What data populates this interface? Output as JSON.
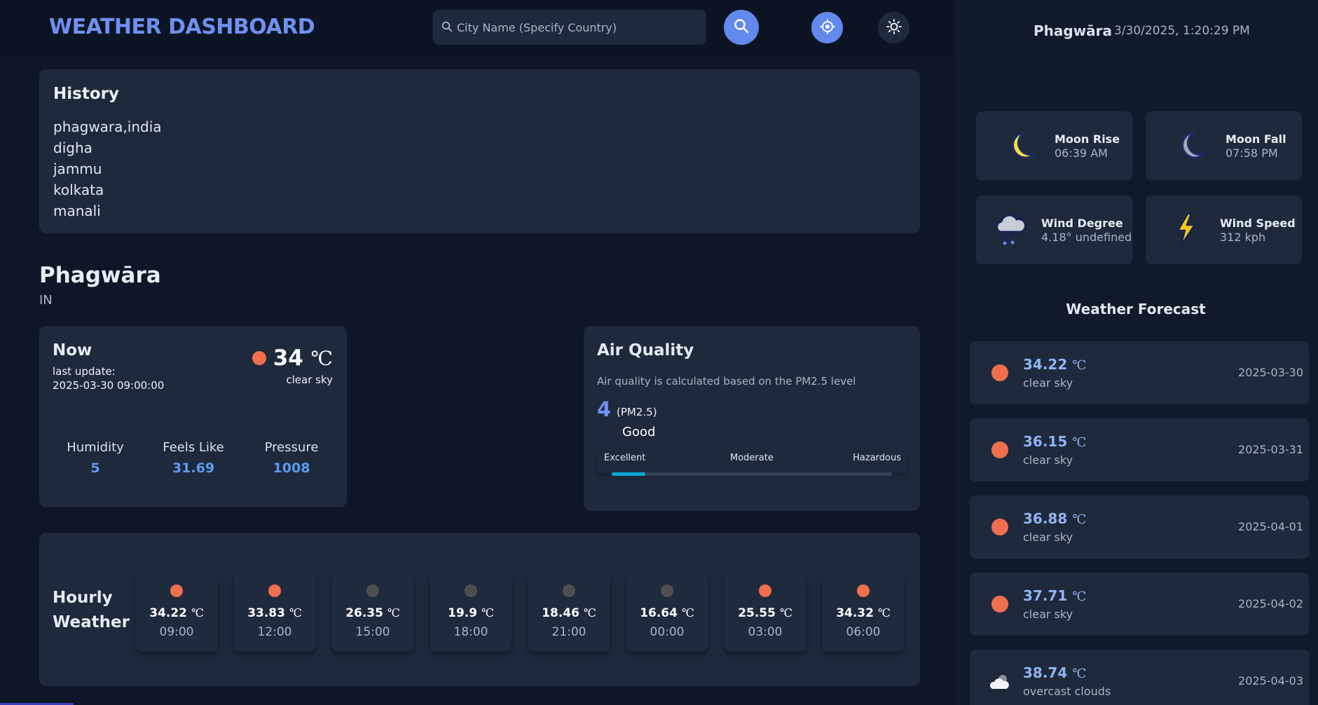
{
  "header": {
    "brand": "WEATHER DASHBOARD",
    "search_placeholder": "City Name (Specify Country)",
    "icons": {
      "search": "search-icon",
      "location": "crosshair-icon",
      "theme": "sun-icon"
    }
  },
  "history": {
    "title": "History",
    "items": [
      "phagwara,india",
      "digha",
      "jammu",
      "kolkata",
      "manali"
    ]
  },
  "location": {
    "city": "Phagwāra",
    "country": "IN"
  },
  "now": {
    "title": "Now",
    "last_update_label": "last update:",
    "last_update": "2025-03-30 09:00:00",
    "temp": "34",
    "unit": "℃",
    "desc": "clear sky",
    "icon": "sun-icon",
    "metrics": [
      {
        "label": "Humidity",
        "value": "5"
      },
      {
        "label": "Feels Like",
        "value": "31.69"
      },
      {
        "label": "Pressure",
        "value": "1008"
      }
    ]
  },
  "air_quality": {
    "title": "Air Quality",
    "note": "Air quality is calculated based on the PM2.5 level",
    "value": "4",
    "pm_label": "(PM2.5)",
    "quality": "Good",
    "scale": [
      "Excellent",
      "Moderate",
      "Hazardous"
    ],
    "level_fraction": 0.12
  },
  "hourly": {
    "title_line1": "Hourly",
    "title_line2": "Weather",
    "unit": "℃",
    "items": [
      {
        "temp": "34.22",
        "time": "09:00",
        "icon": "sun-icon"
      },
      {
        "temp": "33.83",
        "time": "12:00",
        "icon": "sun-icon"
      },
      {
        "temp": "26.35",
        "time": "15:00",
        "icon": "moon-icon"
      },
      {
        "temp": "19.9",
        "time": "18:00",
        "icon": "moon-icon"
      },
      {
        "temp": "18.46",
        "time": "21:00",
        "icon": "moon-icon"
      },
      {
        "temp": "16.64",
        "time": "00:00",
        "icon": "moon-icon"
      },
      {
        "temp": "25.55",
        "time": "03:00",
        "icon": "sun-icon"
      },
      {
        "temp": "34.32",
        "time": "06:00",
        "icon": "sun-icon"
      }
    ]
  },
  "aside": {
    "city": "Phagwāra",
    "datetime": "3/30/2025, 1:20:29 PM",
    "tiles": [
      {
        "label": "Moon Rise",
        "value": "06:39 AM",
        "icon": "crescent-moon-icon"
      },
      {
        "label": "Moon Fall",
        "value": "07:58 PM",
        "icon": "crescent-moon-icon"
      },
      {
        "label": "Wind Degree",
        "value": "4.18° undefined",
        "icon": "storm-cloud-icon"
      },
      {
        "label": "Wind Speed",
        "value": "312 kph",
        "icon": "lightning-icon"
      }
    ],
    "forecast_title": "Weather Forecast",
    "forecast_unit": "℃",
    "forecast": [
      {
        "temp": "34.22",
        "desc": "clear sky",
        "date": "2025-03-30",
        "icon": "sun-icon"
      },
      {
        "temp": "36.15",
        "desc": "clear sky",
        "date": "2025-03-31",
        "icon": "sun-icon"
      },
      {
        "temp": "36.88",
        "desc": "clear sky",
        "date": "2025-04-01",
        "icon": "sun-icon"
      },
      {
        "temp": "37.71",
        "desc": "clear sky",
        "date": "2025-04-02",
        "icon": "sun-icon"
      },
      {
        "temp": "38.74",
        "desc": "overcast clouds",
        "date": "2025-04-03",
        "icon": "cloud-icon"
      }
    ]
  },
  "colors": {
    "accent": "#6289ee",
    "sun": "#f06f4f",
    "value_blue": "#5d9bf2",
    "aq_fill": "#0ea5d6"
  }
}
